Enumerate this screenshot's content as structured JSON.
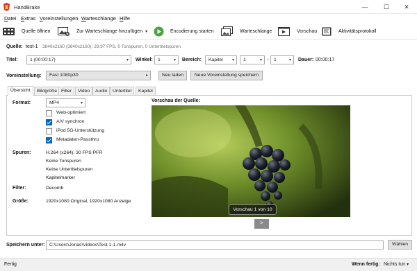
{
  "window": {
    "title": "HandBrake",
    "controls": {
      "minimize": "—",
      "maximize": "☐",
      "close": "✕"
    }
  },
  "menu": [
    "Datei",
    "Extras",
    "Voreinstellungen",
    "Warteschlange",
    "Hilfe"
  ],
  "toolbar": {
    "open_source": "Quelle öffnen",
    "add_queue": "Zur Warteschlange hinzufügen",
    "add_queue_arrow": "▾",
    "start": "Encodierung starten",
    "queue": "Warteschlange",
    "preview": "Vorschau",
    "activity_log": "Aktivitätsprotokoll"
  },
  "source": {
    "label": "Quelle:",
    "name": "test-1",
    "info": "3840x2160 (3840x2160), 29,97 FPS, 0 Tonspuren, 0 Untertitelspuren"
  },
  "title_row": {
    "title_label": "Titel:",
    "title_value": "1 (00:00:17)",
    "angle_label": "Winkel:",
    "angle_value": "1",
    "range_label": "Bereich:",
    "range_type": "Kapitel",
    "range_start": "1",
    "range_sep": "-",
    "range_end": "1",
    "duration_label": "Dauer:",
    "duration_value": "00:00:17"
  },
  "preset": {
    "label": "Voreinstellung:",
    "value": "Fast 1080p30",
    "arrow": "▸",
    "reload": "Neu laden",
    "save_new": "Neue Voreinstellung speichern"
  },
  "tabs": [
    "Übersicht",
    "Bildgröße",
    "Filter",
    "Video",
    "Audio",
    "Untertitel",
    "Kapitel"
  ],
  "summary": {
    "format_label": "Format:",
    "format_value": "MP4",
    "options": [
      {
        "label": "Web-optimiert",
        "checked": false
      },
      {
        "label": "A/V synchron",
        "checked": true
      },
      {
        "label": "iPod 5G-Unterstützung",
        "checked": false
      },
      {
        "label": "Metadaten-Passthru",
        "checked": true
      }
    ],
    "tracks_label": "Spuren:",
    "tracks": [
      "H.264 (x264), 30 FPS PFR",
      "Keine Tonspuren",
      "Keine Untertitelspuren",
      "Kapitelmarker"
    ],
    "filter_label": "Filter:",
    "filter_value": "Decomb",
    "size_label": "Größe:",
    "size_value": "1920x1080 Original, 1920x1080 Anzeige"
  },
  "preview": {
    "label": "Vorschau der Quelle:",
    "badge": "Vorschau 1 von 10",
    "next": ">"
  },
  "save": {
    "label": "Speichern unter:",
    "path": "C:\\Users\\Jonas\\Videos\\Test-1-1.m4v",
    "browse": "Wählen"
  },
  "status": {
    "left": "Fertig",
    "when_done_label": "Wenn fertig:",
    "when_done_value": "Nichts tun",
    "when_done_arrow": "▾"
  }
}
